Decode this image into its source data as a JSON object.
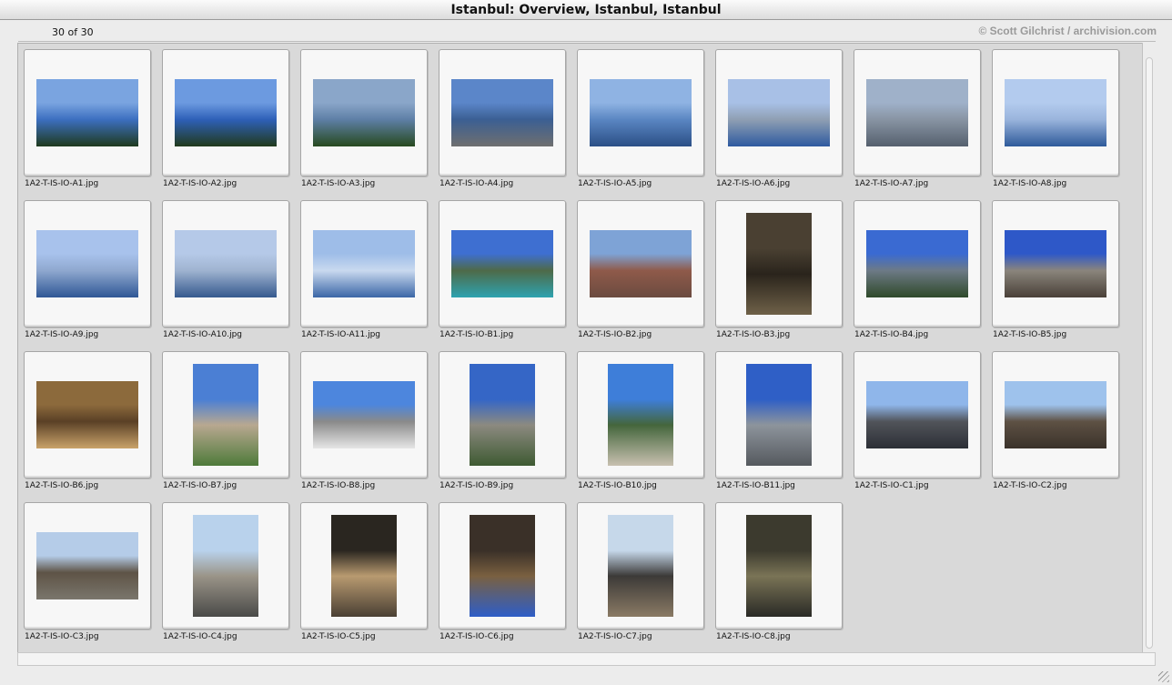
{
  "window": {
    "title": "Istanbul: Overview, Istanbul, Istanbul"
  },
  "header": {
    "count": "30 of 30",
    "credit": "© Scott Gilchrist / archivision.com"
  },
  "items": [
    {
      "file": "1A2-T-IS-IO-A1.jpg",
      "orient": "landscape",
      "colors": [
        "#7aa4e0",
        "#3c6fc0",
        "#1f3a1e"
      ]
    },
    {
      "file": "1A2-T-IS-IO-A2.jpg",
      "orient": "landscape",
      "colors": [
        "#6c9ae0",
        "#2e60b8",
        "#213a1c"
      ]
    },
    {
      "file": "1A2-T-IS-IO-A3.jpg",
      "orient": "landscape",
      "colors": [
        "#8aa6c9",
        "#5e7fa6",
        "#274a1f"
      ]
    },
    {
      "file": "1A2-T-IS-IO-A4.jpg",
      "orient": "landscape",
      "colors": [
        "#5b86c9",
        "#3b5f93",
        "#6f6f6f"
      ]
    },
    {
      "file": "1A2-T-IS-IO-A5.jpg",
      "orient": "landscape",
      "colors": [
        "#8fb3e3",
        "#5a86c2",
        "#2b4f86"
      ]
    },
    {
      "file": "1A2-T-IS-IO-A6.jpg",
      "orient": "landscape",
      "colors": [
        "#a8c0e6",
        "#8f9fb3",
        "#2e5aa0"
      ]
    },
    {
      "file": "1A2-T-IS-IO-A7.jpg",
      "orient": "landscape",
      "colors": [
        "#9fb1c9",
        "#8894a3",
        "#55606e"
      ]
    },
    {
      "file": "1A2-T-IS-IO-A8.jpg",
      "orient": "landscape",
      "colors": [
        "#b3cbee",
        "#9ab4dc",
        "#2e5a9a"
      ]
    },
    {
      "file": "1A2-T-IS-IO-A9.jpg",
      "orient": "landscape",
      "colors": [
        "#a8c2ec",
        "#8fa8cf",
        "#2f5795"
      ]
    },
    {
      "file": "1A2-T-IS-IO-A10.jpg",
      "orient": "landscape",
      "colors": [
        "#b5c9e8",
        "#9fb3d0",
        "#35598e"
      ]
    },
    {
      "file": "1A2-T-IS-IO-A11.jpg",
      "orient": "landscape",
      "colors": [
        "#9ebde8",
        "#c9d9ef",
        "#3b66a6"
      ]
    },
    {
      "file": "1A2-T-IS-IO-B1.jpg",
      "orient": "landscape",
      "colors": [
        "#3e6fd1",
        "#4e6a48",
        "#2ea3b0"
      ]
    },
    {
      "file": "1A2-T-IS-IO-B2.jpg",
      "orient": "landscape",
      "colors": [
        "#7ea3d6",
        "#8f5a4a",
        "#6b4b40"
      ]
    },
    {
      "file": "1A2-T-IS-IO-B3.jpg",
      "orient": "portrait",
      "colors": [
        "#4a4032",
        "#2a241c",
        "#6f6148"
      ]
    },
    {
      "file": "1A2-T-IS-IO-B4.jpg",
      "orient": "landscape",
      "colors": [
        "#3a6ad2",
        "#6d7a86",
        "#2f4a2a"
      ]
    },
    {
      "file": "1A2-T-IS-IO-B5.jpg",
      "orient": "landscape",
      "colors": [
        "#2e58c8",
        "#8a857c",
        "#4a4038"
      ]
    },
    {
      "file": "1A2-T-IS-IO-B6.jpg",
      "orient": "landscape",
      "colors": [
        "#8c6a3c",
        "#5a4026",
        "#c9a36a"
      ]
    },
    {
      "file": "1A2-T-IS-IO-B7.jpg",
      "orient": "portrait",
      "colors": [
        "#4b7fd4",
        "#b8a890",
        "#4e7a3a"
      ]
    },
    {
      "file": "1A2-T-IS-IO-B8.jpg",
      "orient": "landscape",
      "colors": [
        "#4d86dd",
        "#8a8a8a",
        "#e6e6e6"
      ]
    },
    {
      "file": "1A2-T-IS-IO-B9.jpg",
      "orient": "portrait",
      "colors": [
        "#3566c6",
        "#8c8a80",
        "#3e5a32"
      ]
    },
    {
      "file": "1A2-T-IS-IO-B10.jpg",
      "orient": "portrait",
      "colors": [
        "#3e7ed9",
        "#44663c",
        "#c8c0b0"
      ]
    },
    {
      "file": "1A2-T-IS-IO-B11.jpg",
      "orient": "portrait",
      "colors": [
        "#2f5fc6",
        "#8d949c",
        "#55595e"
      ]
    },
    {
      "file": "1A2-T-IS-IO-C1.jpg",
      "orient": "landscape",
      "colors": [
        "#8fb6ea",
        "#51545a",
        "#2c2f36"
      ]
    },
    {
      "file": "1A2-T-IS-IO-C2.jpg",
      "orient": "landscape",
      "colors": [
        "#9ec2ec",
        "#5e5144",
        "#3a322a"
      ]
    },
    {
      "file": "1A2-T-IS-IO-C3.jpg",
      "orient": "landscape",
      "colors": [
        "#b5cce8",
        "#5e5346",
        "#7a766c"
      ]
    },
    {
      "file": "1A2-T-IS-IO-C4.jpg",
      "orient": "portrait",
      "colors": [
        "#b9d2ec",
        "#9a9488",
        "#4a4a48"
      ]
    },
    {
      "file": "1A2-T-IS-IO-C5.jpg",
      "orient": "portrait",
      "colors": [
        "#2a2620",
        "#b89a70",
        "#4a4034"
      ]
    },
    {
      "file": "1A2-T-IS-IO-C6.jpg",
      "orient": "portrait",
      "colors": [
        "#3a3028",
        "#7a6040",
        "#2e5ec8"
      ]
    },
    {
      "file": "1A2-T-IS-IO-C7.jpg",
      "orient": "portrait",
      "colors": [
        "#c6d8ea",
        "#3c3a38",
        "#8a7a64"
      ]
    },
    {
      "file": "1A2-T-IS-IO-C8.jpg",
      "orient": "portrait",
      "colors": [
        "#3c3a2e",
        "#7a7456",
        "#2a2a26"
      ]
    }
  ]
}
